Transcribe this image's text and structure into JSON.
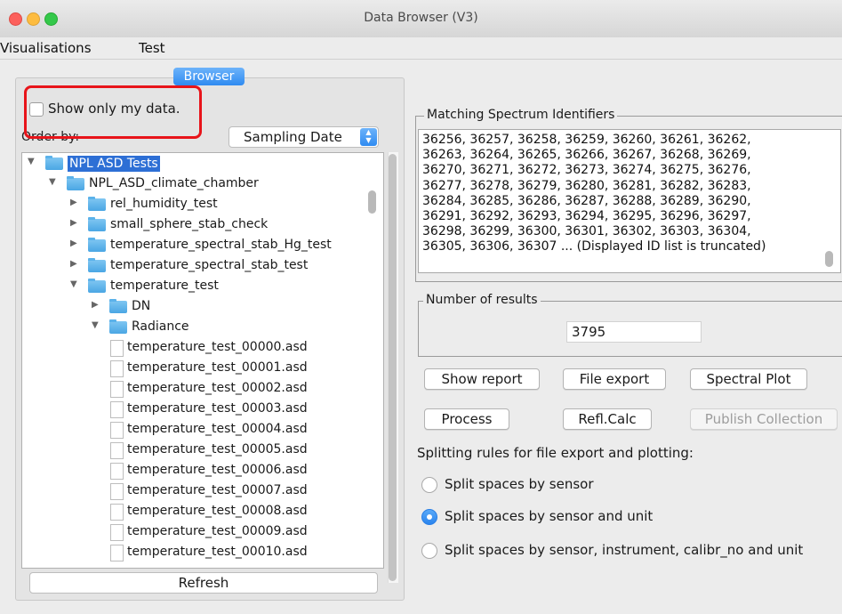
{
  "window": {
    "title": "Data Browser (V3)"
  },
  "menu": [
    "Visualisations",
    "Test"
  ],
  "tab": {
    "label": "Browser"
  },
  "browser": {
    "show_only_label": "Show only my data.",
    "order_by_label": "Order by:",
    "order_by_value": "Sampling Date",
    "refresh_label": "Refresh",
    "tree": [
      {
        "label": "NPL ASD Tests",
        "type": "folder",
        "level": 0,
        "expanded": true,
        "selected": true
      },
      {
        "label": "NPL_ASD_climate_chamber",
        "type": "folder",
        "level": 1,
        "expanded": true
      },
      {
        "label": "rel_humidity_test",
        "type": "folder",
        "level": 2,
        "expanded": false
      },
      {
        "label": "small_sphere_stab_check",
        "type": "folder",
        "level": 2,
        "expanded": false
      },
      {
        "label": "temperature_spectral_stab_Hg_test",
        "type": "folder",
        "level": 2,
        "expanded": false
      },
      {
        "label": "temperature_spectral_stab_test",
        "type": "folder",
        "level": 2,
        "expanded": false
      },
      {
        "label": "temperature_test",
        "type": "folder",
        "level": 2,
        "expanded": true
      },
      {
        "label": "DN",
        "type": "folder",
        "level": 3,
        "expanded": false
      },
      {
        "label": "Radiance",
        "type": "folder",
        "level": 3,
        "expanded": true
      },
      {
        "label": "temperature_test_00000.asd",
        "type": "file",
        "level": 4
      },
      {
        "label": "temperature_test_00001.asd",
        "type": "file",
        "level": 4
      },
      {
        "label": "temperature_test_00002.asd",
        "type": "file",
        "level": 4
      },
      {
        "label": "temperature_test_00003.asd",
        "type": "file",
        "level": 4
      },
      {
        "label": "temperature_test_00004.asd",
        "type": "file",
        "level": 4
      },
      {
        "label": "temperature_test_00005.asd",
        "type": "file",
        "level": 4
      },
      {
        "label": "temperature_test_00006.asd",
        "type": "file",
        "level": 4
      },
      {
        "label": "temperature_test_00007.asd",
        "type": "file",
        "level": 4
      },
      {
        "label": "temperature_test_00008.asd",
        "type": "file",
        "level": 4
      },
      {
        "label": "temperature_test_00009.asd",
        "type": "file",
        "level": 4
      },
      {
        "label": "temperature_test_00010.asd",
        "type": "file",
        "level": 4
      }
    ]
  },
  "matching": {
    "title": "Matching Spectrum Identifiers",
    "ids_text": "36256, 36257, 36258, 36259, 36260, 36261, 36262,\n36263, 36264, 36265, 36266, 36267, 36268, 36269,\n36270, 36271, 36272, 36273, 36274, 36275, 36276,\n36277, 36278, 36279, 36280, 36281, 36282, 36283,\n36284, 36285, 36286, 36287, 36288, 36289, 36290,\n36291, 36292, 36293, 36294, 36295, 36296, 36297,\n36298, 36299, 36300, 36301, 36302, 36303, 36304,\n36305, 36306, 36307 ... (Displayed ID list is truncated)"
  },
  "results": {
    "title": "Number of results",
    "count": "3795"
  },
  "buttons": {
    "show_report": "Show report",
    "file_export": "File export",
    "spectral_plot": "Spectral Plot",
    "process": "Process",
    "refl_calc": "Refl.Calc",
    "publish_collection": "Publish Collection"
  },
  "splitting": {
    "label": "Splitting rules for file export and plotting:",
    "options": [
      {
        "label": "Split spaces by sensor",
        "selected": false
      },
      {
        "label": "Split spaces by sensor and unit",
        "selected": true
      },
      {
        "label": "Split spaces by sensor, instrument, calibr_no and unit",
        "selected": false
      }
    ]
  }
}
